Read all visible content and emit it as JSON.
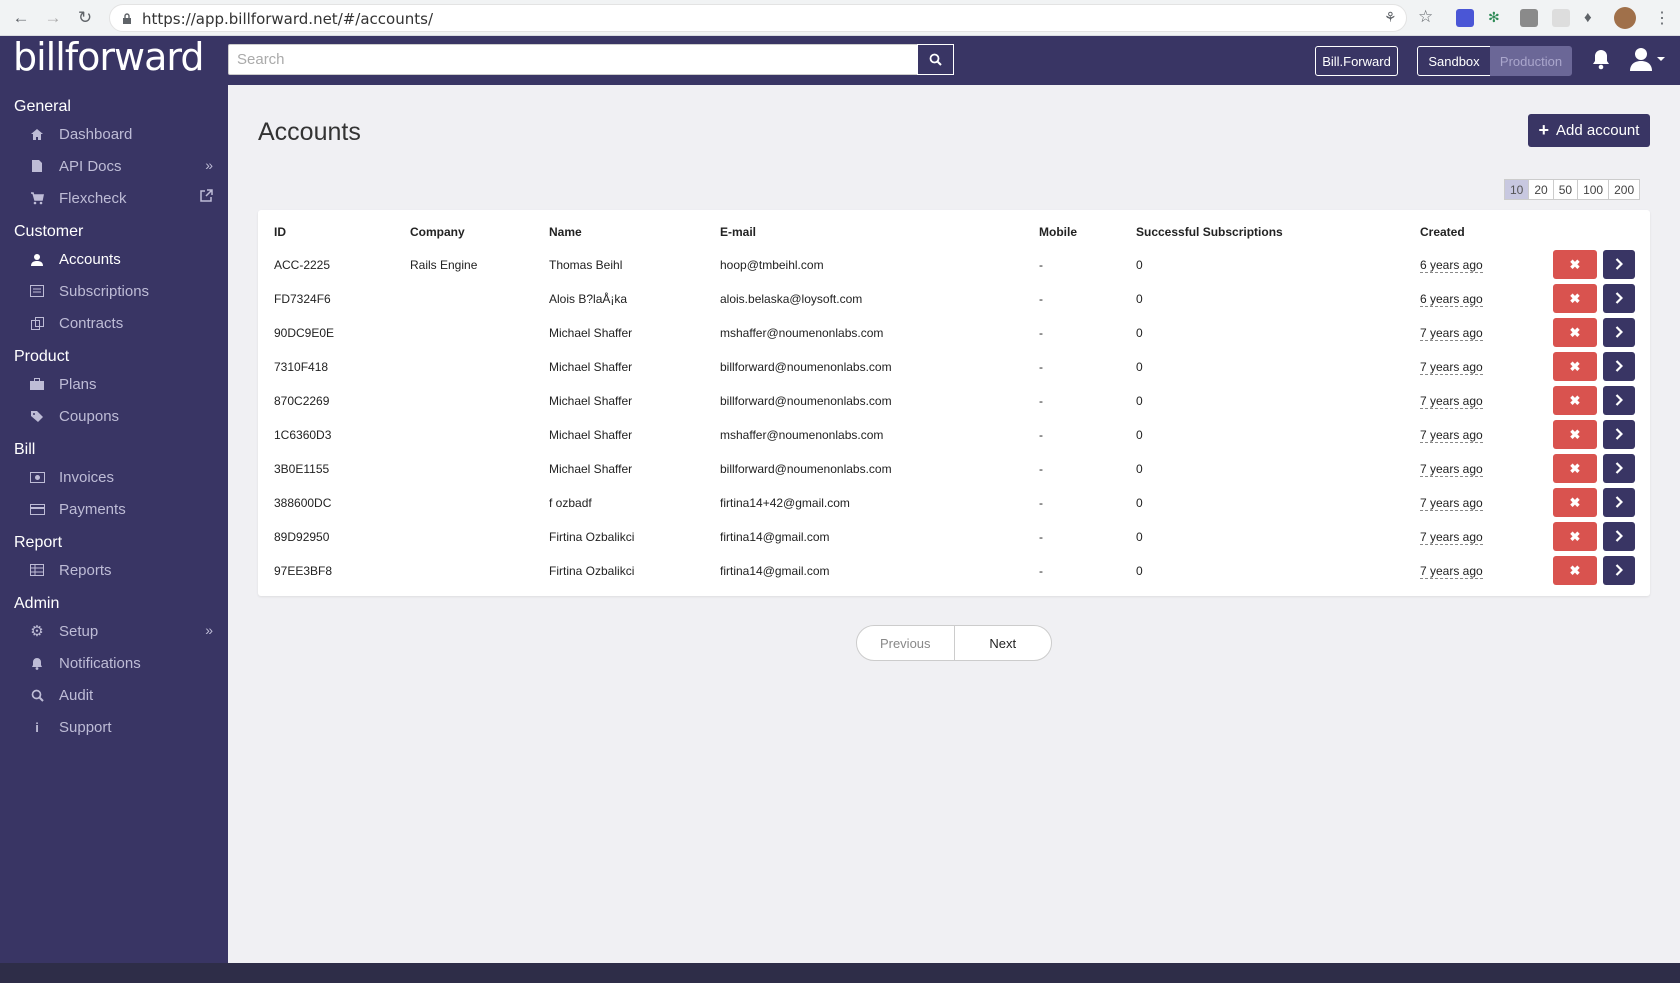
{
  "browser": {
    "url": "https://app.billforward.net/#/accounts/"
  },
  "header": {
    "logo": "billforward",
    "search_placeholder": "Search",
    "org_button": "Bill.Forward",
    "env_sandbox": "Sandbox",
    "env_production": "Production"
  },
  "sidebar": {
    "sections": [
      {
        "title": "General",
        "items": [
          {
            "label": "Dashboard",
            "icon": "home-icon"
          },
          {
            "label": "API Docs",
            "icon": "file-icon"
          },
          {
            "label": "Flexcheck",
            "icon": "cart-icon"
          }
        ]
      },
      {
        "title": "Customer",
        "items": [
          {
            "label": "Accounts",
            "icon": "user-icon"
          },
          {
            "label": "Subscriptions",
            "icon": "list-icon"
          },
          {
            "label": "Contracts",
            "icon": "copy-icon"
          }
        ]
      },
      {
        "title": "Product",
        "items": [
          {
            "label": "Plans",
            "icon": "briefcase-icon"
          },
          {
            "label": "Coupons",
            "icon": "tags-icon"
          }
        ]
      },
      {
        "title": "Bill",
        "items": [
          {
            "label": "Invoices",
            "icon": "money-icon"
          },
          {
            "label": "Payments",
            "icon": "credit-card-icon"
          }
        ]
      },
      {
        "title": "Report",
        "items": [
          {
            "label": "Reports",
            "icon": "table-icon"
          }
        ]
      },
      {
        "title": "Admin",
        "items": [
          {
            "label": "Setup",
            "icon": "gear-icon"
          },
          {
            "label": "Notifications",
            "icon": "bell-icon"
          },
          {
            "label": "Audit",
            "icon": "search-icon"
          },
          {
            "label": "Support",
            "icon": "info-icon"
          }
        ]
      }
    ]
  },
  "main": {
    "title": "Accounts",
    "add_button": "Add account",
    "page_sizes": [
      "10",
      "20",
      "50",
      "100",
      "200"
    ],
    "selected_page_size": "10",
    "columns": [
      "ID",
      "Company",
      "Name",
      "E-mail",
      "Mobile",
      "Successful Subscriptions",
      "Created"
    ],
    "rows": [
      [
        "ACC-2225",
        "Rails Engine",
        "Thomas Beihl",
        "hoop@tmbeihl.com",
        "-",
        "0",
        "6 years ago"
      ],
      [
        "FD7324F6",
        "",
        "Alois B?laÅ¡ka",
        "alois.belaska@loysoft.com",
        "-",
        "0",
        "6 years ago"
      ],
      [
        "90DC9E0E",
        "",
        "Michael Shaffer",
        "mshaffer@noumenonlabs.com",
        "-",
        "0",
        "7 years ago"
      ],
      [
        "7310F418",
        "",
        "Michael Shaffer",
        "billforward@noumenonlabs.com",
        "-",
        "0",
        "7 years ago"
      ],
      [
        "870C2269",
        "",
        "Michael Shaffer",
        "billforward@noumenonlabs.com",
        "-",
        "0",
        "7 years ago"
      ],
      [
        "1C6360D3",
        "",
        "Michael Shaffer",
        "mshaffer@noumenonlabs.com",
        "-",
        "0",
        "7 years ago"
      ],
      [
        "3B0E1155",
        "",
        "Michael Shaffer",
        "billforward@noumenonlabs.com",
        "-",
        "0",
        "7 years ago"
      ],
      [
        "388600DC",
        "",
        "f ozbadf",
        "firtina14+42@gmail.com",
        "-",
        "0",
        "7 years ago"
      ],
      [
        "89D92950",
        "",
        "Firtina Ozbalikci",
        "firtina14@gmail.com",
        "-",
        "0",
        "7 years ago"
      ],
      [
        "97EE3BF8",
        "",
        "Firtina Ozbalikci",
        "firtina14@gmail.com",
        "-",
        "0",
        "7 years ago"
      ]
    ],
    "pagination": {
      "previous": "Previous",
      "next": "Next"
    }
  },
  "colors": {
    "brand": "#393564",
    "danger": "#d9534f"
  }
}
